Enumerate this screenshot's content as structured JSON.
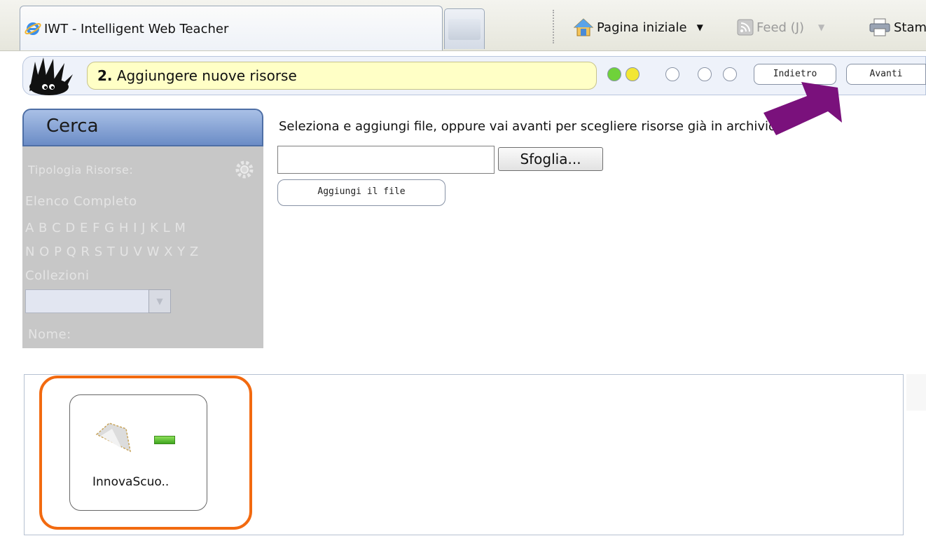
{
  "browser": {
    "tab_title": "IWT - Intelligent Web Teacher",
    "commands": {
      "home_label": "Pagina iniziale",
      "feed_label": "Feed (J)",
      "print_label": "Stam"
    }
  },
  "wizard": {
    "step_number": "2.",
    "step_title": "Aggiungere nuove risorse",
    "progress_dots": [
      {
        "color": "#6fd23a"
      },
      {
        "color": "#f2e634"
      },
      {
        "color": "#ffffff"
      },
      {
        "color": "#ffffff"
      },
      {
        "color": "#ffffff"
      }
    ],
    "back_label": "Indietro",
    "next_label": "Avanti"
  },
  "search_panel": {
    "title": "Cerca",
    "resource_type_label": "Tipologia Risorse:",
    "full_list_label": "Elenco Completo",
    "alphabet_row1": "A B C D E F G H I J  K L M",
    "alphabet_row2": "N O P Q R S T U V W X Y Z",
    "collections_label": "Collezioni",
    "name_label": "Nome:"
  },
  "upload": {
    "instruction": "Seleziona e aggiungi file, oppure vai avanti per scegliere risorse già in archivio.",
    "file_value": "",
    "browse_label": "Sfoglia...",
    "add_file_label": "Aggiungi il file"
  },
  "files": [
    {
      "name": "InnovaScuo.."
    }
  ],
  "colors": {
    "highlight": "#f26a10",
    "arrow": "#7a117c",
    "panel_header": "#6b8cc6"
  }
}
